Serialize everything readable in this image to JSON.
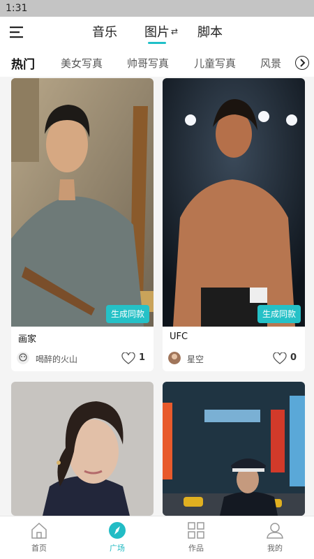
{
  "status_bar": {
    "time": "1:31"
  },
  "header": {
    "menu_icon": "hamburger-icon",
    "tabs": [
      {
        "label": "音乐",
        "active": false
      },
      {
        "label": "图片",
        "active": true
      },
      {
        "label": "脚本",
        "active": false
      }
    ],
    "swap_symbol": "⇄"
  },
  "categories": {
    "items": [
      "热门",
      "美女写真",
      "帅哥写真",
      "儿童写真",
      "风景"
    ],
    "selected": "热门",
    "next_icon": "chevron-right-icon"
  },
  "cards": [
    {
      "title": "画家",
      "author": "喝醉的火山",
      "likes": "1",
      "button": "生成同款",
      "avatar_icon": "cartoon-avatar"
    },
    {
      "title": "UFC",
      "author": "星空",
      "likes": "0",
      "button": "生成同款",
      "avatar_icon": "photo-avatar"
    },
    {
      "title": "",
      "author": "",
      "likes": "",
      "button": ""
    },
    {
      "title": "",
      "author": "",
      "likes": "",
      "button": ""
    }
  ],
  "bottom_nav": [
    {
      "label": "首页",
      "icon": "home-icon",
      "active": false
    },
    {
      "label": "广场",
      "icon": "compass-icon",
      "active": true
    },
    {
      "label": "作品",
      "icon": "grid-icon",
      "active": false
    },
    {
      "label": "我的",
      "icon": "user-icon",
      "active": false
    }
  ],
  "colors": {
    "accent": "#25c1c7",
    "background": "#f4f4f4"
  }
}
